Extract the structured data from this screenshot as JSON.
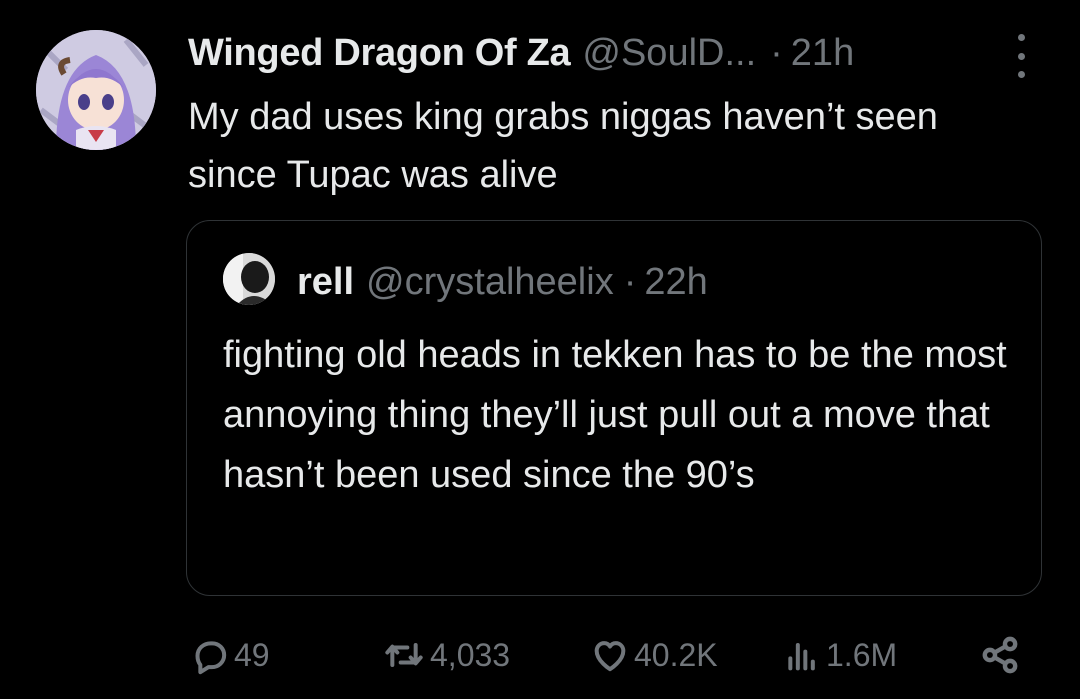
{
  "tweet": {
    "author_name": "Winged Dragon Of Za",
    "author_handle": "@SoulD...",
    "separator": "·",
    "time": "21h",
    "text": "My dad uses king grabs niggas haven’t seen since Tupac was alive",
    "avatar_icon": "anime-girl-avatar-icon"
  },
  "quoted_tweet": {
    "author_name": "rell",
    "author_handle": "@crystalheelix",
    "separator": "·",
    "time": "22h",
    "text": "fighting old heads in tekken has to be the most annoying thing they’ll just pull out a move that hasn’t been used since the 90’s",
    "avatar_icon": "profile-photo-icon"
  },
  "actions": {
    "replies": "49",
    "reposts": "4,033",
    "likes": "40.2K",
    "views": "1.6M"
  },
  "colors": {
    "background": "#000000",
    "text": "#e7e9ea",
    "secondary": "#71767b",
    "border": "#2f3336"
  }
}
